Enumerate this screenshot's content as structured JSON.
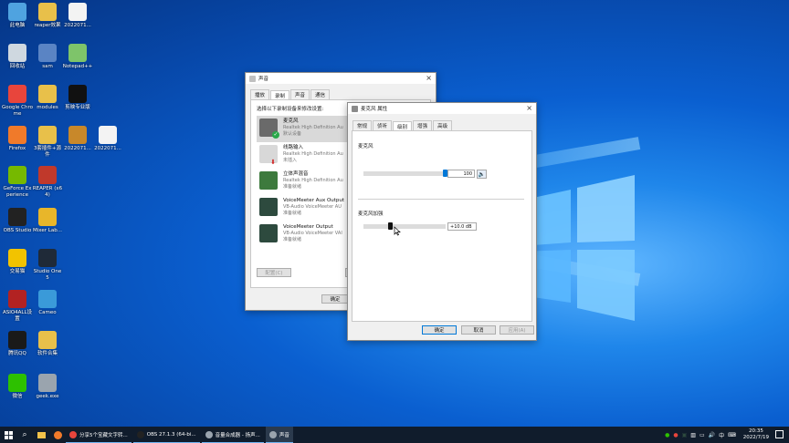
{
  "desktop": {
    "icons": [
      {
        "label": "此电脑",
        "color": "#4fa3e0"
      },
      {
        "label": "reaper效果",
        "color": "#e8c04a"
      },
      {
        "label": "2022071...",
        "color": "#f3f3f3"
      },
      {
        "label": "回收站",
        "color": "#cfd8e0"
      },
      {
        "label": "sam",
        "color": "#5a84c4"
      },
      {
        "label": "Notepad++",
        "color": "#7ec46a"
      },
      {
        "label": "Google Chrome",
        "color": "#e8453c"
      },
      {
        "label": "modules",
        "color": "#e8c04a"
      },
      {
        "label": "剪映专业版",
        "color": "#111111"
      },
      {
        "label": "Firefox",
        "color": "#f07a2a"
      },
      {
        "label": "3套插件+源件",
        "color": "#e8c04a"
      },
      {
        "label": "2022071...",
        "color": "#c8882a"
      },
      {
        "label": "2022071...",
        "color": "#f3f3f3"
      },
      {
        "label": "GeForce Experience",
        "color": "#76b900"
      },
      {
        "label": "REAPER (x64)",
        "color": "#c0392b"
      },
      {
        "label": "OBS Studio",
        "color": "#222222"
      },
      {
        "label": "Mixer Lab...",
        "color": "#e8b62a"
      },
      {
        "label": "交易猫",
        "color": "#f2c300"
      },
      {
        "label": "Studio One 5",
        "color": "#1f2a38"
      },
      {
        "label": "ASIO4ALL设置",
        "color": "#b22222"
      },
      {
        "label": "Cameo",
        "color": "#3a9ad9"
      },
      {
        "label": "腾讯QQ",
        "color": "#1a1a1a"
      },
      {
        "label": "软件合集",
        "color": "#e8c04a"
      },
      {
        "label": "微信",
        "color": "#2dc100"
      },
      {
        "label": "geek.exe",
        "color": "#9aa4ae"
      }
    ]
  },
  "sound_dialog": {
    "title": "声音",
    "tabs": [
      "播放",
      "录制",
      "声音",
      "通信"
    ],
    "active_tab": 1,
    "instruction": "选择以下录制设备来修改设置:",
    "devices": [
      {
        "name": "麦克风",
        "desc": "Realtek High Definition Au",
        "status": "默认设备",
        "color": "#6a6a6a"
      },
      {
        "name": "线路输入",
        "desc": "Realtek High Definition Au",
        "status": "未插入",
        "color": "#d8d8d8"
      },
      {
        "name": "立体声混音",
        "desc": "Realtek High Definition Au",
        "status": "准备就绪",
        "color": "#3d7a3d"
      },
      {
        "name": "VoiceMeeter Aux Output",
        "desc": "VB-Audio VoiceMeeter AU",
        "status": "准备就绪",
        "color": "#2d4a3e"
      },
      {
        "name": "VoiceMeeter Output",
        "desc": "VB-Audio VoiceMeeter VAI",
        "status": "准备就绪",
        "color": "#2d4a3e"
      }
    ],
    "configure_label": "配置(C)",
    "ok_label": "确定"
  },
  "props_dialog": {
    "title": "麦克风 属性",
    "tabs": [
      "常规",
      "侦听",
      "级别",
      "增强",
      "高级"
    ],
    "active_tab": 2,
    "mic_label": "麦克风",
    "mic_level": 100,
    "mic_value": "100",
    "boost_label": "麦克风加强",
    "boost_fraction": 0.33,
    "boost_value": "+10.0 dB",
    "ok_label": "确定",
    "cancel_label": "取消",
    "apply_label": "应用(A)"
  },
  "taskbar": {
    "apps": [
      {
        "label": "分享5个宝藏文字转...",
        "color": "#e8453c",
        "active": false
      },
      {
        "label": "OBS 27.1.3 (64-bi...",
        "color": "#222222",
        "active": false
      },
      {
        "label": "音量合成器 - 扬声...",
        "color": "#9aa4ae",
        "active": false
      },
      {
        "label": "声音",
        "color": "#9aa4ae",
        "active": true
      }
    ],
    "time": "20:35",
    "date": "2022/7/19"
  }
}
